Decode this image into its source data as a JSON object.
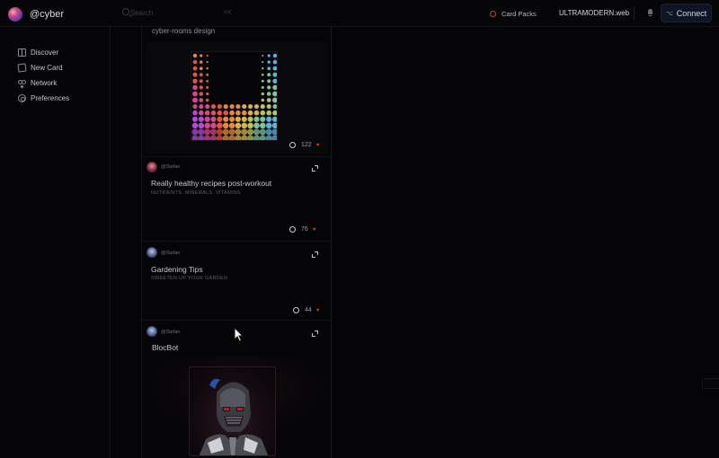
{
  "header": {
    "username": "@cyber",
    "search_placeholder": "Search",
    "search_shortcut": "⌘K",
    "card_packs_label": "Card Packs",
    "domain_label": "ULTRAMODERN.web",
    "connect_label": "Connect"
  },
  "sidebar": {
    "items": [
      {
        "label": "Discover",
        "icon": "book-icon"
      },
      {
        "label": "New Card",
        "icon": "cards-icon"
      },
      {
        "label": "Network",
        "icon": "network-icon"
      },
      {
        "label": "Preferences",
        "icon": "gear-icon"
      }
    ]
  },
  "feed": {
    "top_post": {
      "text": "cyber-rooms design",
      "comments_count": "122"
    },
    "cards": [
      {
        "handle": "@Stefan",
        "title": "Really healthy recipes post-workout",
        "subtitle": "NUTRIENTS, MINERALS, VITAMINS",
        "count": "76"
      },
      {
        "handle": "@Stefan",
        "title": "Gardening Tips",
        "subtitle": "SWEETEN UP YOUR GARDEN",
        "count": "44"
      },
      {
        "handle": "@Stefan",
        "title": "BlocBot",
        "subtitle": "",
        "count": ""
      }
    ]
  },
  "colors": {
    "background": "#050507",
    "accent_red": "#c8413b",
    "connect_bg": "#0f1524"
  }
}
